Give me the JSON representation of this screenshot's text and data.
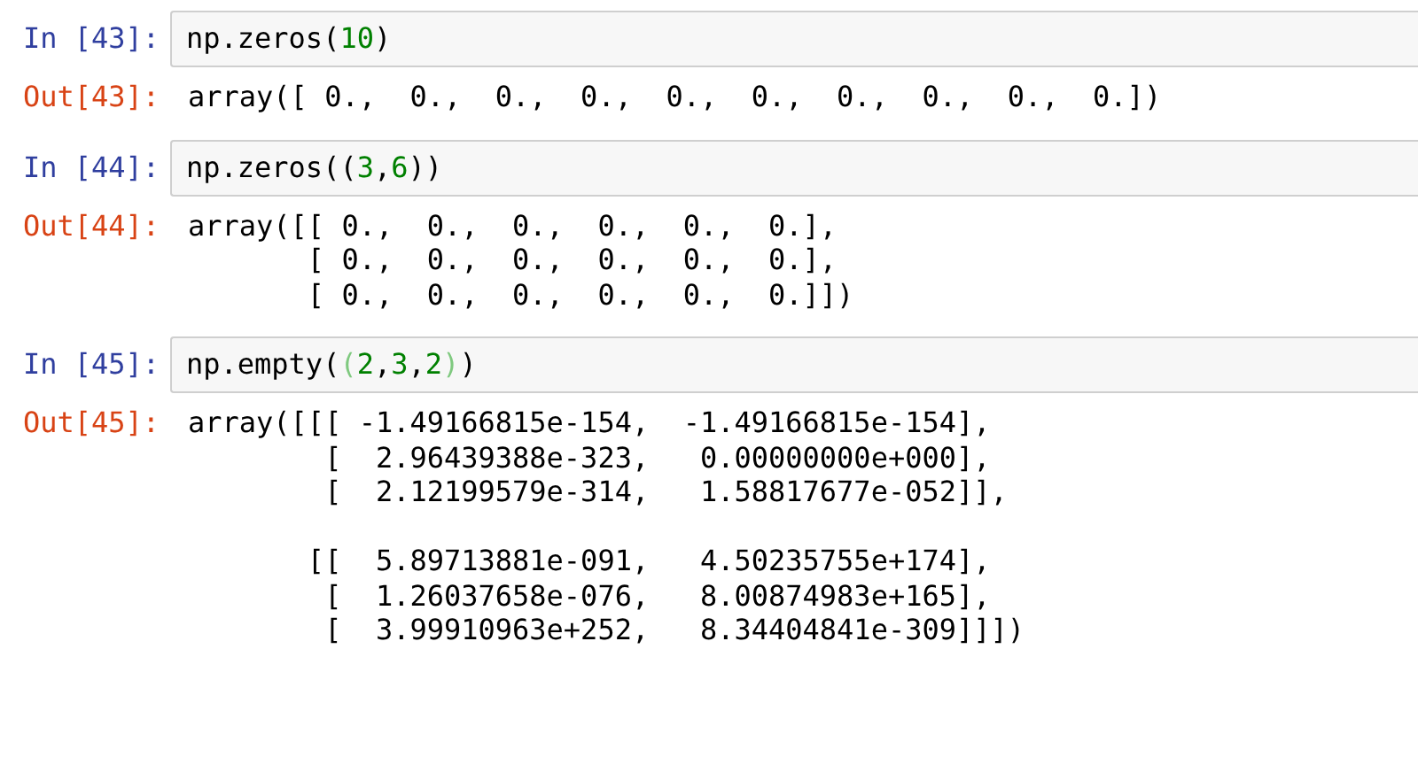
{
  "cells": [
    {
      "in_prompt": "In [43]:",
      "code": [
        {
          "text": "np.zeros(",
          "kind": "plain"
        },
        {
          "text": "10",
          "kind": "number"
        },
        {
          "text": ")",
          "kind": "plain"
        }
      ],
      "out_prompt": "Out[43]:",
      "output": [
        [
          "array([ 0.,  0.,  0.,  0.,  0.,  0.,  0.,  0.,  0.,  0.])"
        ]
      ]
    },
    {
      "in_prompt": "In [44]:",
      "code": [
        {
          "text": "np.zeros((",
          "kind": "plain"
        },
        {
          "text": "3",
          "kind": "number"
        },
        {
          "text": ",",
          "kind": "plain"
        },
        {
          "text": "6",
          "kind": "number"
        },
        {
          "text": "))",
          "kind": "plain"
        }
      ],
      "out_prompt": "Out[44]:",
      "output": [
        [
          "array([[ 0.,  0.,  0.,  0.,  0.,  0.],",
          "       [ 0.,  0.,  0.,  0.,  0.,  0.],",
          "       [ 0.,  0.,  0.,  0.,  0.,  0.]])"
        ]
      ]
    },
    {
      "in_prompt": "In [45]:",
      "code": [
        {
          "text": "np.empty(",
          "kind": "plain"
        },
        {
          "text": "(",
          "kind": "match"
        },
        {
          "text": "2",
          "kind": "number"
        },
        {
          "text": ",",
          "kind": "plain"
        },
        {
          "text": "3",
          "kind": "number"
        },
        {
          "text": ",",
          "kind": "plain"
        },
        {
          "text": "2",
          "kind": "number"
        },
        {
          "text": ")",
          "kind": "match"
        },
        {
          "text": ")",
          "kind": "plain"
        }
      ],
      "out_prompt": "Out[45]:",
      "output": [
        [
          "array([[[ -1.49166815e-154,  -1.49166815e-154],",
          "        [  2.96439388e-323,   0.00000000e+000],",
          "        [  2.12199579e-314,   1.58817677e-052]],"
        ],
        [
          "       [[  5.89713881e-091,   4.50235755e+174],",
          "        [  1.26037658e-076,   8.00874983e+165],",
          "        [  3.99910963e+252,   8.34404841e-309]]])"
        ]
      ]
    }
  ]
}
